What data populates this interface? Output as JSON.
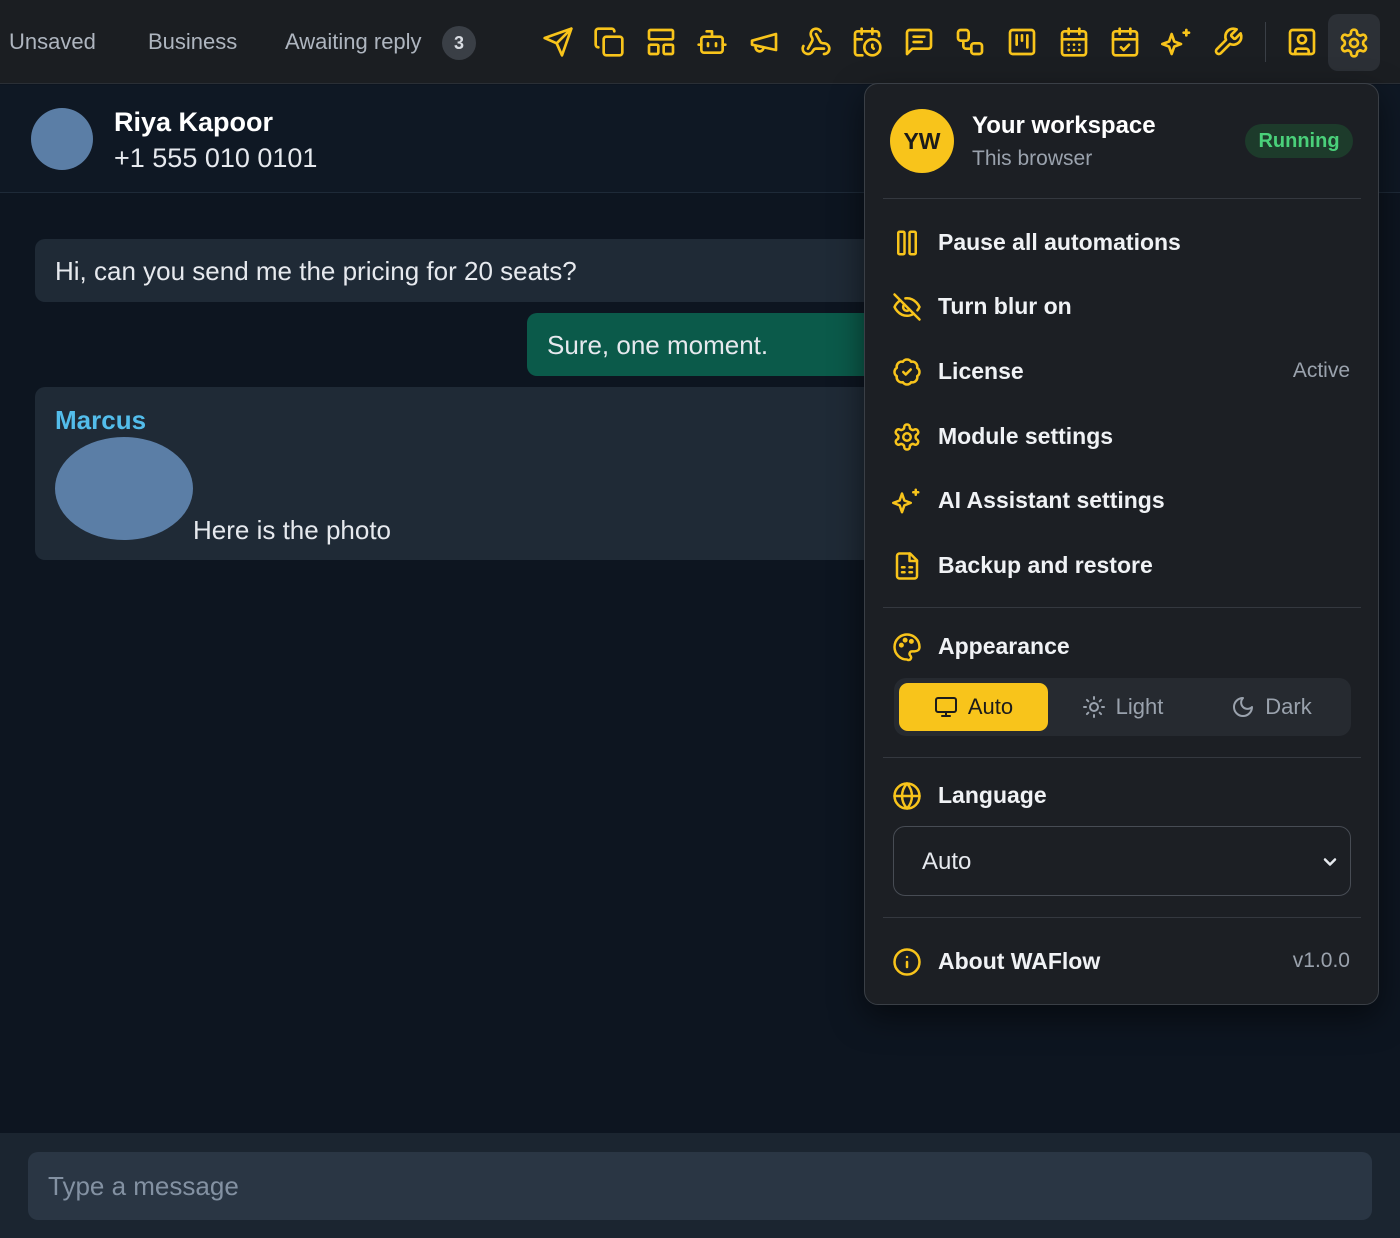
{
  "topbar": {
    "filters": [
      {
        "label": "Unsaved"
      },
      {
        "label": "Business"
      },
      {
        "label": "Awaiting reply",
        "count": "3"
      }
    ],
    "tools": [
      "send-icon",
      "copy-icon",
      "layout-icon",
      "bot-icon",
      "megaphone-icon",
      "webhook-icon",
      "calendar-clock-icon",
      "message-square-icon",
      "workflow-icon",
      "kanban-icon",
      "calendar-grid-icon",
      "calendar-check-icon",
      "sparkles-icon",
      "wrench-icon",
      "contact-icon",
      "gear-icon"
    ],
    "accent": "#f8c41b"
  },
  "chat": {
    "contact_name": "Riya Kapoor",
    "contact_phone": "+1 555 010 0101",
    "messages": [
      {
        "text": "Hi, can you send me the pricing for 20 seats?"
      },
      {
        "text": "Sure, one moment."
      },
      {
        "sender": "Marcus",
        "caption": "Here is the photo"
      }
    ]
  },
  "composer": {
    "placeholder": "Type a message"
  },
  "menu": {
    "workspace": {
      "initials": "YW",
      "title": "Your workspace",
      "subtitle": "This browser",
      "status": "Running"
    },
    "items": [
      {
        "label": "Pause all automations",
        "icon": "pause-icon"
      },
      {
        "label": "Turn blur on",
        "icon": "eye-off-icon"
      },
      {
        "label": "License",
        "icon": "badge-check-icon",
        "value": "Active"
      },
      {
        "label": "Module settings",
        "icon": "gear-icon"
      },
      {
        "label": "AI Assistant settings",
        "icon": "sparkles-icon"
      },
      {
        "label": "Backup and restore",
        "icon": "file-spreadsheet-icon"
      }
    ],
    "appearance": {
      "label": "Appearance",
      "options": [
        "Auto",
        "Light",
        "Dark"
      ],
      "selected": "Auto"
    },
    "language": {
      "label": "Language",
      "value": "Auto"
    },
    "about": {
      "label": "About WAFlow",
      "version": "v1.0.0"
    }
  }
}
